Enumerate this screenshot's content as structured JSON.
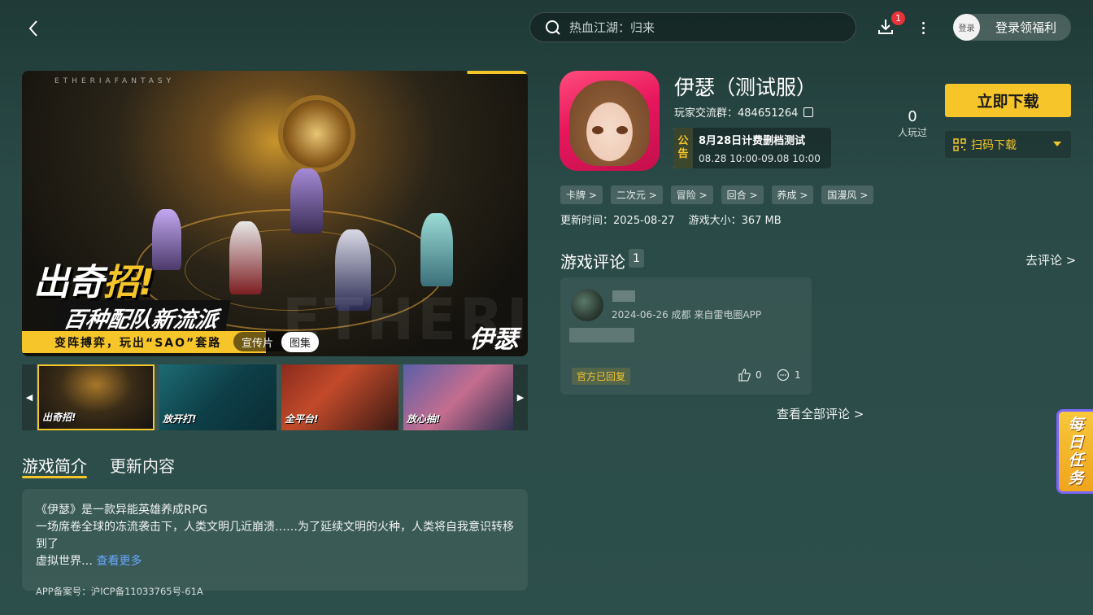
{
  "header": {
    "search_placeholder": "热血江湖：归来",
    "download_badge": "1",
    "login_avatar_text": "登录",
    "login_label": "登录领福利"
  },
  "media": {
    "hero": {
      "brand_tagline": "ETHERIAFANTASY",
      "headline_pre": "出奇",
      "headline_em": "招!",
      "headline2": "百种配队新流派",
      "strip_text": "变阵搏弈，玩出“SAO”套路",
      "logo": "伊瑟",
      "watermark": "ETHERIA"
    },
    "tabs": [
      {
        "label": "宣传片",
        "active": false
      },
      {
        "label": "图集",
        "active": true
      }
    ],
    "thumbnails": [
      {
        "label": "出奇招!",
        "active": true
      },
      {
        "label": "放开打!",
        "active": false
      },
      {
        "label": "全平台!",
        "active": false
      },
      {
        "label": "放心抽!",
        "active": false
      }
    ]
  },
  "intro": {
    "tabs": [
      "游戏简介",
      "更新内容"
    ],
    "line1": "《伊瑟》是一款异能英雄养成RPG",
    "line2": "一场席卷全球的冻流袭击下，人类文明几近崩溃……为了延续文明的火种，人类将自我意识转移到了",
    "line3": "虚拟世界…",
    "see_more": "查看更多",
    "icp": "APP备案号：沪ICP备11033765号-61A"
  },
  "app": {
    "title": "伊瑟（测试服）",
    "group": "玩家交流群：484651264",
    "notice_tag_1": "公",
    "notice_tag_2": "告",
    "notice_title": "8月28日计费删档测试",
    "notice_date": "08.28 10:00-09.08 10:00",
    "played_count": "0",
    "played_label": "人玩过",
    "download_label": "立即下载",
    "qr_label": "扫码下载",
    "tags": [
      "卡牌 >",
      "二次元 >",
      "冒险 >",
      "回合 >",
      "养成 >",
      "国漫风 >"
    ],
    "update_time": "更新时间：2025-08-27",
    "size": "游戏大小：367 MB"
  },
  "reviews": {
    "title": "游戏评论",
    "count": "1",
    "go_review": "去评论 >",
    "item": {
      "meta": "2024-06-26 成都 来自雷电圈APP",
      "official": "官方已回复",
      "likes": "0",
      "comments": "1"
    },
    "see_all": "查看全部评论 >"
  },
  "daily_task": [
    "每",
    "日",
    "任",
    "务"
  ],
  "colors": {
    "accent": "#f5c52a",
    "background": "#2d4f4b",
    "badge": "#e8333a",
    "link": "#69a8ff"
  }
}
